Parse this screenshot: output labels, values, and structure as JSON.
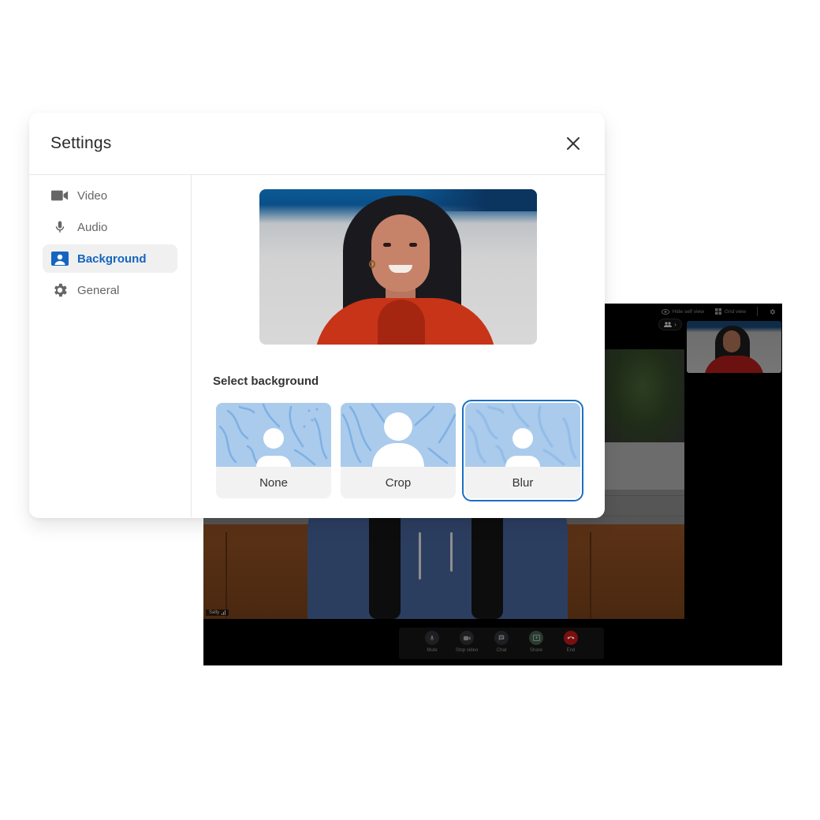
{
  "settings": {
    "title": "Settings",
    "close_icon": "close-icon",
    "nav": [
      {
        "label": "Video",
        "icon": "video-camera-icon",
        "active": false
      },
      {
        "label": "Audio",
        "icon": "microphone-icon",
        "active": false
      },
      {
        "label": "Background",
        "icon": "person-portrait-icon",
        "active": true
      },
      {
        "label": "General",
        "icon": "gear-icon",
        "active": false
      }
    ],
    "background": {
      "section_label": "Select background",
      "options": [
        {
          "label": "None",
          "selected": false
        },
        {
          "label": "Crop",
          "selected": false
        },
        {
          "label": "Blur",
          "selected": true
        }
      ]
    }
  },
  "meeting": {
    "topbar": {
      "hide_self_view": "Hide self view",
      "grid_view": "Grid view"
    },
    "participant_name": "Sally",
    "controls": [
      {
        "label": "Mute",
        "icon": "microphone-icon"
      },
      {
        "label": "Stop video",
        "icon": "video-camera-icon"
      },
      {
        "label": "Chat",
        "icon": "chat-icon"
      },
      {
        "label": "Share",
        "icon": "share-screen-icon"
      },
      {
        "label": "End",
        "icon": "end-call-icon"
      }
    ]
  },
  "colors": {
    "accent": "#1565c0",
    "selected_outline": "#1a6fc4",
    "thumb_bg": "#aacbec",
    "end_call": "#7a0f0f"
  }
}
